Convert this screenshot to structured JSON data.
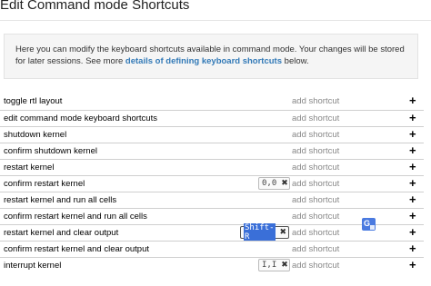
{
  "dialog": {
    "title": "Edit Command mode Shortcuts",
    "info_text": "Here you can modify the keyboard shortcuts available in command mode. Your changes will be stored for later sessions. See more ",
    "info_link": "details of defining keyboard shortcuts",
    "info_tail": " below."
  },
  "add_label": "add shortcut",
  "plus_label": "+",
  "remove_label": "✖",
  "rows": [
    {
      "label": "toggle rtl layout"
    },
    {
      "label": "edit command mode keyboard shortcuts"
    },
    {
      "label": "shutdown kernel"
    },
    {
      "label": "confirm shutdown kernel"
    },
    {
      "label": "restart kernel"
    },
    {
      "label": "confirm restart kernel",
      "shortcut": "0,0"
    },
    {
      "label": "restart kernel and run all cells"
    },
    {
      "label": "confirm restart kernel and run all cells"
    },
    {
      "label": "restart kernel and clear output",
      "shortcut_editing": "Shift-R"
    },
    {
      "label": "confirm restart kernel and clear output"
    },
    {
      "label": "interrupt kernel",
      "shortcut": "I,I"
    }
  ],
  "colors": {
    "link": "#337ab7",
    "selection": "#3a6fd8"
  }
}
